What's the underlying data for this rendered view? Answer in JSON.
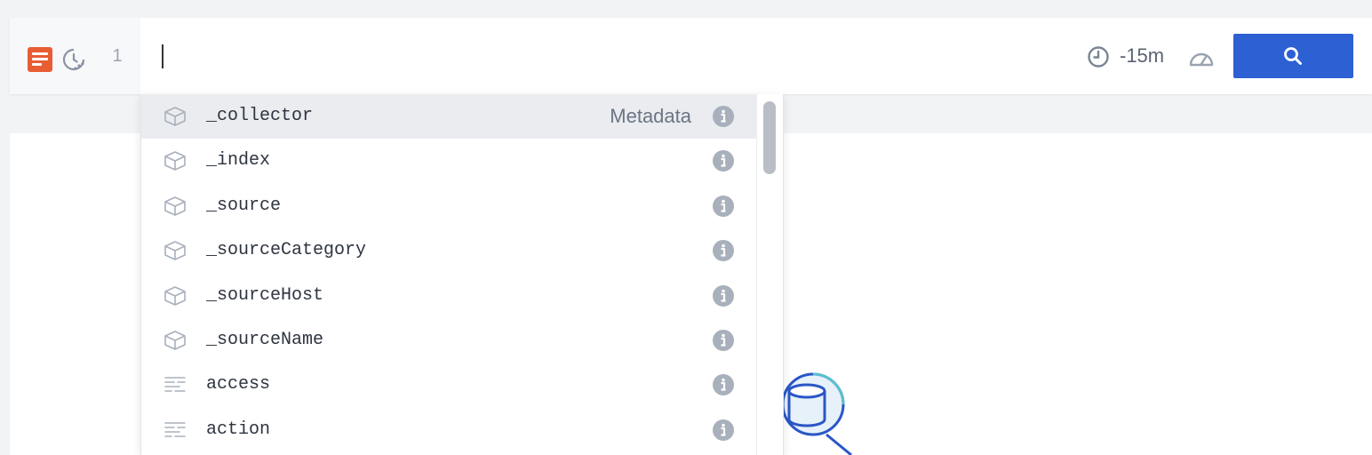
{
  "querybar": {
    "line_number": "1",
    "time_range": "-15m",
    "icons": [
      "logs-icon",
      "history-icon",
      "clock-icon",
      "gauge-icon",
      "search-icon"
    ],
    "accent_color": "#2c60d3",
    "logs_icon_color": "#e85d34"
  },
  "autocomplete": {
    "items": [
      {
        "label": "_collector",
        "type_label": "Metadata",
        "icon": "cube-icon",
        "selected": true
      },
      {
        "label": "_index",
        "type_label": "",
        "icon": "cube-icon",
        "selected": false
      },
      {
        "label": "_source",
        "type_label": "",
        "icon": "cube-icon",
        "selected": false
      },
      {
        "label": "_sourceCategory",
        "type_label": "",
        "icon": "cube-icon",
        "selected": false
      },
      {
        "label": "_sourceHost",
        "type_label": "",
        "icon": "cube-icon",
        "selected": false
      },
      {
        "label": "_sourceName",
        "type_label": "",
        "icon": "cube-icon",
        "selected": false
      },
      {
        "label": "access",
        "type_label": "",
        "icon": "field-lines-icon",
        "selected": false
      },
      {
        "label": "action",
        "type_label": "",
        "icon": "field-lines-icon",
        "selected": false
      }
    ]
  }
}
